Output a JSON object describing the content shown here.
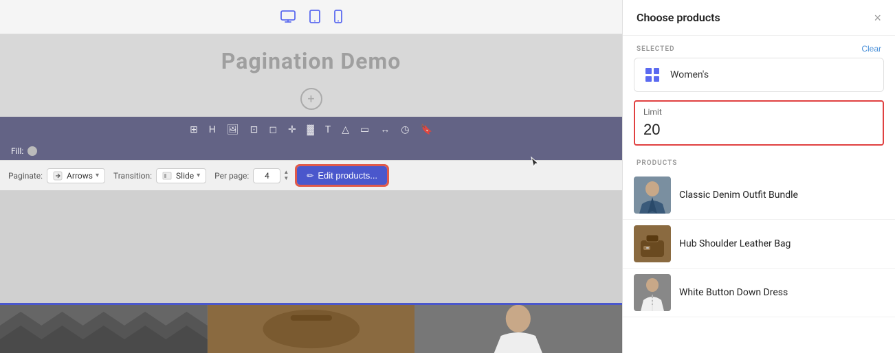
{
  "editor": {
    "device_bar": {
      "desktop_label": "Desktop",
      "tablet_label": "Tablet",
      "mobile_label": "Mobile"
    },
    "page_title": "Pagination Demo",
    "add_section_label": "+",
    "fill_label": "Fill:",
    "toolbar_icons": [
      "grid",
      "heading",
      "image",
      "crop",
      "square",
      "move",
      "text",
      "T",
      "triangle",
      "box",
      "arrows",
      "clock",
      "bookmark"
    ],
    "bottom_bar": {
      "paginate_label": "Paginate:",
      "arrows_label": "Arrows",
      "transition_label": "Transition:",
      "slide_label": "Slide",
      "per_page_label": "Per page:",
      "per_page_value": "4",
      "edit_products_label": "Edit products..."
    }
  },
  "panel": {
    "title": "Choose products",
    "close_label": "×",
    "selected_label": "SELECTED",
    "clear_label": "Clear",
    "selected_item_name": "Women's",
    "limit_label": "Limit",
    "limit_value": "20",
    "products_label": "PRODUCTS",
    "products": [
      {
        "name": "Classic Denim Outfit Bundle",
        "img_type": "denim"
      },
      {
        "name": "Hub Shoulder Leather Bag",
        "img_type": "bag"
      },
      {
        "name": "White Button Down Dress",
        "img_type": "dress"
      }
    ]
  }
}
